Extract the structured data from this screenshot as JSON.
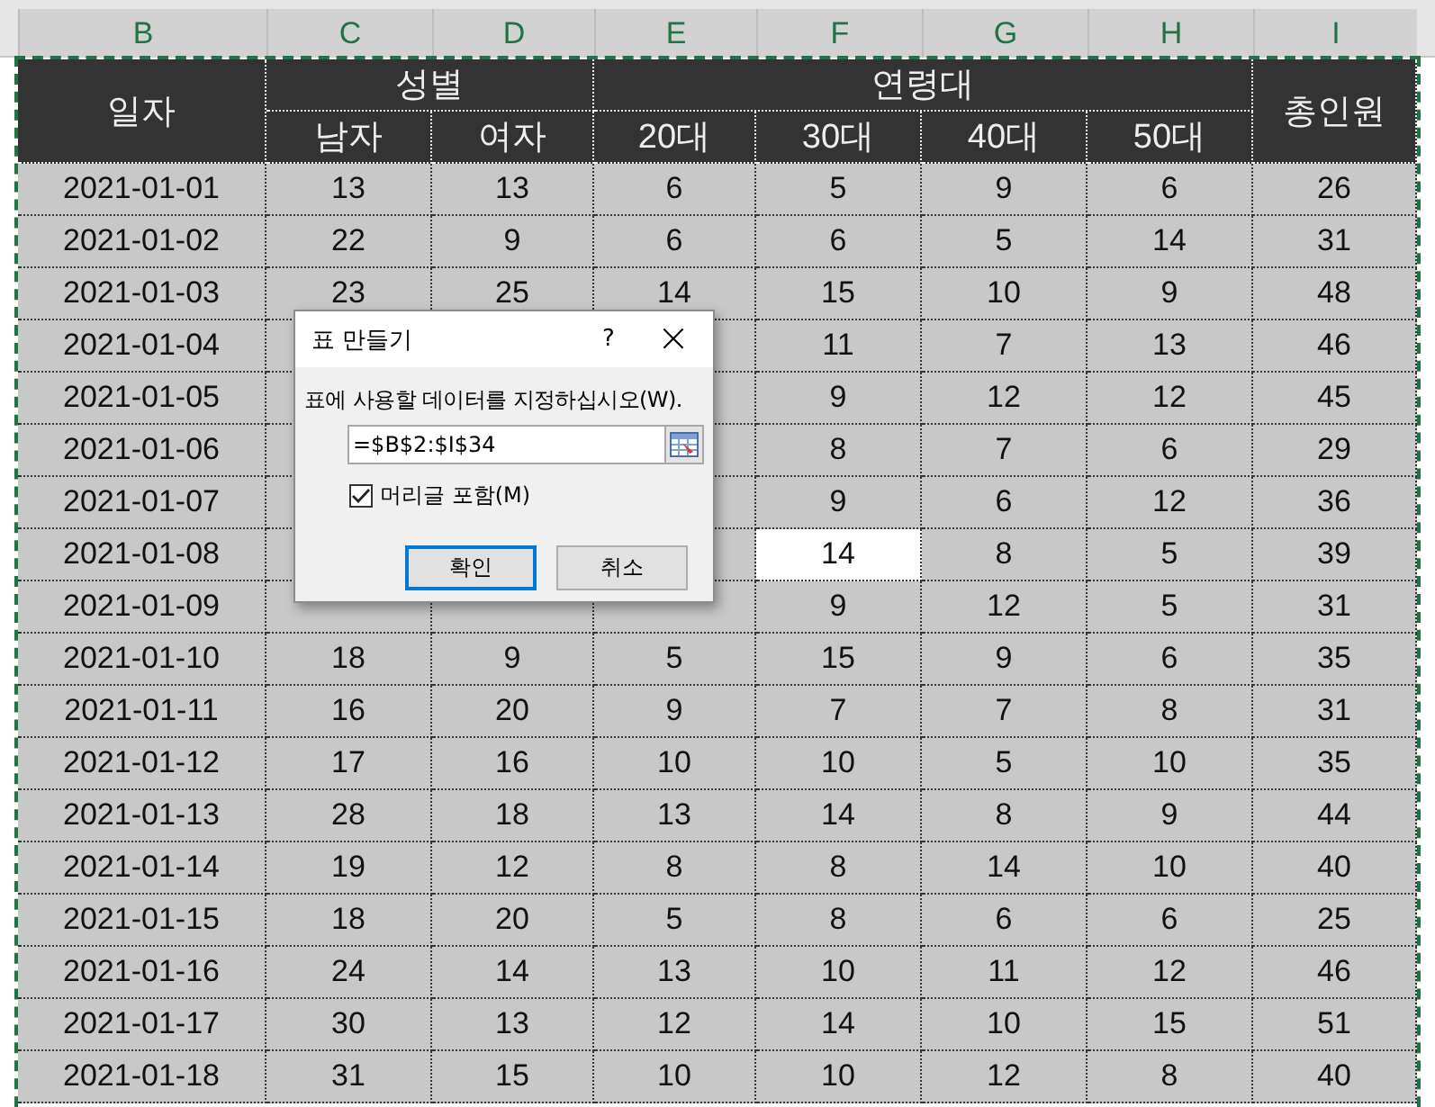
{
  "column_headers": [
    "B",
    "C",
    "D",
    "E",
    "F",
    "G",
    "H",
    "I"
  ],
  "table": {
    "headers": {
      "date": "일자",
      "gender": {
        "label": "성별",
        "columns": [
          "남자",
          "여자"
        ]
      },
      "age": {
        "label": "연령대",
        "columns": [
          "20대",
          "30대",
          "40대",
          "50대"
        ]
      },
      "total": "총인원"
    },
    "rows": [
      {
        "date": "2021-01-01",
        "cells": [
          {
            "value": "13",
            "selected": false
          },
          {
            "value": "13",
            "selected": false
          },
          {
            "value": "6",
            "selected": false
          },
          {
            "value": "5",
            "selected": false
          },
          {
            "value": "9",
            "selected": false
          },
          {
            "value": "6",
            "selected": false
          },
          {
            "value": "26",
            "selected": false
          }
        ]
      },
      {
        "date": "2021-01-02",
        "cells": [
          {
            "value": "22",
            "selected": false
          },
          {
            "value": "9",
            "selected": false
          },
          {
            "value": "6",
            "selected": false
          },
          {
            "value": "6",
            "selected": false
          },
          {
            "value": "5",
            "selected": false
          },
          {
            "value": "14",
            "selected": false
          },
          {
            "value": "31",
            "selected": false
          }
        ]
      },
      {
        "date": "2021-01-03",
        "cells": [
          {
            "value": "23",
            "selected": false
          },
          {
            "value": "25",
            "selected": false
          },
          {
            "value": "14",
            "selected": false
          },
          {
            "value": "15",
            "selected": false
          },
          {
            "value": "10",
            "selected": false
          },
          {
            "value": "9",
            "selected": false
          },
          {
            "value": "48",
            "selected": false
          }
        ]
      },
      {
        "date": "2021-01-04",
        "cells": [
          null,
          null,
          null,
          {
            "value": "11",
            "selected": false
          },
          {
            "value": "7",
            "selected": false
          },
          {
            "value": "13",
            "selected": false
          },
          {
            "value": "46",
            "selected": false
          }
        ]
      },
      {
        "date": "2021-01-05",
        "cells": [
          null,
          null,
          null,
          {
            "value": "9",
            "selected": false
          },
          {
            "value": "12",
            "selected": false
          },
          {
            "value": "12",
            "selected": false
          },
          {
            "value": "45",
            "selected": false
          }
        ]
      },
      {
        "date": "2021-01-06",
        "cells": [
          null,
          null,
          null,
          {
            "value": "8",
            "selected": false
          },
          {
            "value": "7",
            "selected": false
          },
          {
            "value": "6",
            "selected": false
          },
          {
            "value": "29",
            "selected": false
          }
        ]
      },
      {
        "date": "2021-01-07",
        "cells": [
          null,
          null,
          null,
          {
            "value": "9",
            "selected": false
          },
          {
            "value": "6",
            "selected": false
          },
          {
            "value": "12",
            "selected": false
          },
          {
            "value": "36",
            "selected": false
          }
        ]
      },
      {
        "date": "2021-01-08",
        "cells": [
          null,
          null,
          null,
          {
            "value": "14",
            "selected": true
          },
          {
            "value": "8",
            "selected": false
          },
          {
            "value": "5",
            "selected": false
          },
          {
            "value": "39",
            "selected": false
          }
        ]
      },
      {
        "date": "2021-01-09",
        "cells": [
          null,
          null,
          null,
          {
            "value": "9",
            "selected": false
          },
          {
            "value": "12",
            "selected": false
          },
          {
            "value": "5",
            "selected": false
          },
          {
            "value": "31",
            "selected": false
          }
        ]
      },
      {
        "date": "2021-01-10",
        "cells": [
          {
            "value": "18",
            "selected": false
          },
          {
            "value": "9",
            "selected": false
          },
          {
            "value": "5",
            "selected": false
          },
          {
            "value": "15",
            "selected": false
          },
          {
            "value": "9",
            "selected": false
          },
          {
            "value": "6",
            "selected": false
          },
          {
            "value": "35",
            "selected": false
          }
        ]
      },
      {
        "date": "2021-01-11",
        "cells": [
          {
            "value": "16",
            "selected": false
          },
          {
            "value": "20",
            "selected": false
          },
          {
            "value": "9",
            "selected": false
          },
          {
            "value": "7",
            "selected": false
          },
          {
            "value": "7",
            "selected": false
          },
          {
            "value": "8",
            "selected": false
          },
          {
            "value": "31",
            "selected": false
          }
        ]
      },
      {
        "date": "2021-01-12",
        "cells": [
          {
            "value": "17",
            "selected": false
          },
          {
            "value": "16",
            "selected": false
          },
          {
            "value": "10",
            "selected": false
          },
          {
            "value": "10",
            "selected": false
          },
          {
            "value": "5",
            "selected": false
          },
          {
            "value": "10",
            "selected": false
          },
          {
            "value": "35",
            "selected": false
          }
        ]
      },
      {
        "date": "2021-01-13",
        "cells": [
          {
            "value": "28",
            "selected": false
          },
          {
            "value": "18",
            "selected": false
          },
          {
            "value": "13",
            "selected": false
          },
          {
            "value": "14",
            "selected": false
          },
          {
            "value": "8",
            "selected": false
          },
          {
            "value": "9",
            "selected": false
          },
          {
            "value": "44",
            "selected": false
          }
        ]
      },
      {
        "date": "2021-01-14",
        "cells": [
          {
            "value": "19",
            "selected": false
          },
          {
            "value": "12",
            "selected": false
          },
          {
            "value": "8",
            "selected": false
          },
          {
            "value": "8",
            "selected": false
          },
          {
            "value": "14",
            "selected": false
          },
          {
            "value": "10",
            "selected": false
          },
          {
            "value": "40",
            "selected": false
          }
        ]
      },
      {
        "date": "2021-01-15",
        "cells": [
          {
            "value": "18",
            "selected": false
          },
          {
            "value": "20",
            "selected": false
          },
          {
            "value": "5",
            "selected": false
          },
          {
            "value": "8",
            "selected": false
          },
          {
            "value": "6",
            "selected": false
          },
          {
            "value": "6",
            "selected": false
          },
          {
            "value": "25",
            "selected": false
          }
        ]
      },
      {
        "date": "2021-01-16",
        "cells": [
          {
            "value": "24",
            "selected": false
          },
          {
            "value": "14",
            "selected": false
          },
          {
            "value": "13",
            "selected": false
          },
          {
            "value": "10",
            "selected": false
          },
          {
            "value": "11",
            "selected": false
          },
          {
            "value": "12",
            "selected": false
          },
          {
            "value": "46",
            "selected": false
          }
        ]
      },
      {
        "date": "2021-01-17",
        "cells": [
          {
            "value": "30",
            "selected": false
          },
          {
            "value": "13",
            "selected": false
          },
          {
            "value": "12",
            "selected": false
          },
          {
            "value": "14",
            "selected": false
          },
          {
            "value": "10",
            "selected": false
          },
          {
            "value": "15",
            "selected": false
          },
          {
            "value": "51",
            "selected": false
          }
        ]
      },
      {
        "date": "2021-01-18",
        "cells": [
          {
            "value": "31",
            "selected": false
          },
          {
            "value": "15",
            "selected": false
          },
          {
            "value": "10",
            "selected": false
          },
          {
            "value": "10",
            "selected": false
          },
          {
            "value": "12",
            "selected": false
          },
          {
            "value": "8",
            "selected": false
          },
          {
            "value": "40",
            "selected": false
          }
        ]
      }
    ]
  },
  "dialog": {
    "title": "표 만들기",
    "help": "?",
    "close": "×",
    "prompt": "표에 사용할 데이터를 지정하십시오(W).",
    "range": {
      "value": "=$B$2:$I$34"
    },
    "header_checkbox": {
      "label": "머리글 포함(M)",
      "checked": true
    },
    "buttons": [
      {
        "label": "확인",
        "default": true
      },
      {
        "label": "취소",
        "default": false
      }
    ]
  }
}
